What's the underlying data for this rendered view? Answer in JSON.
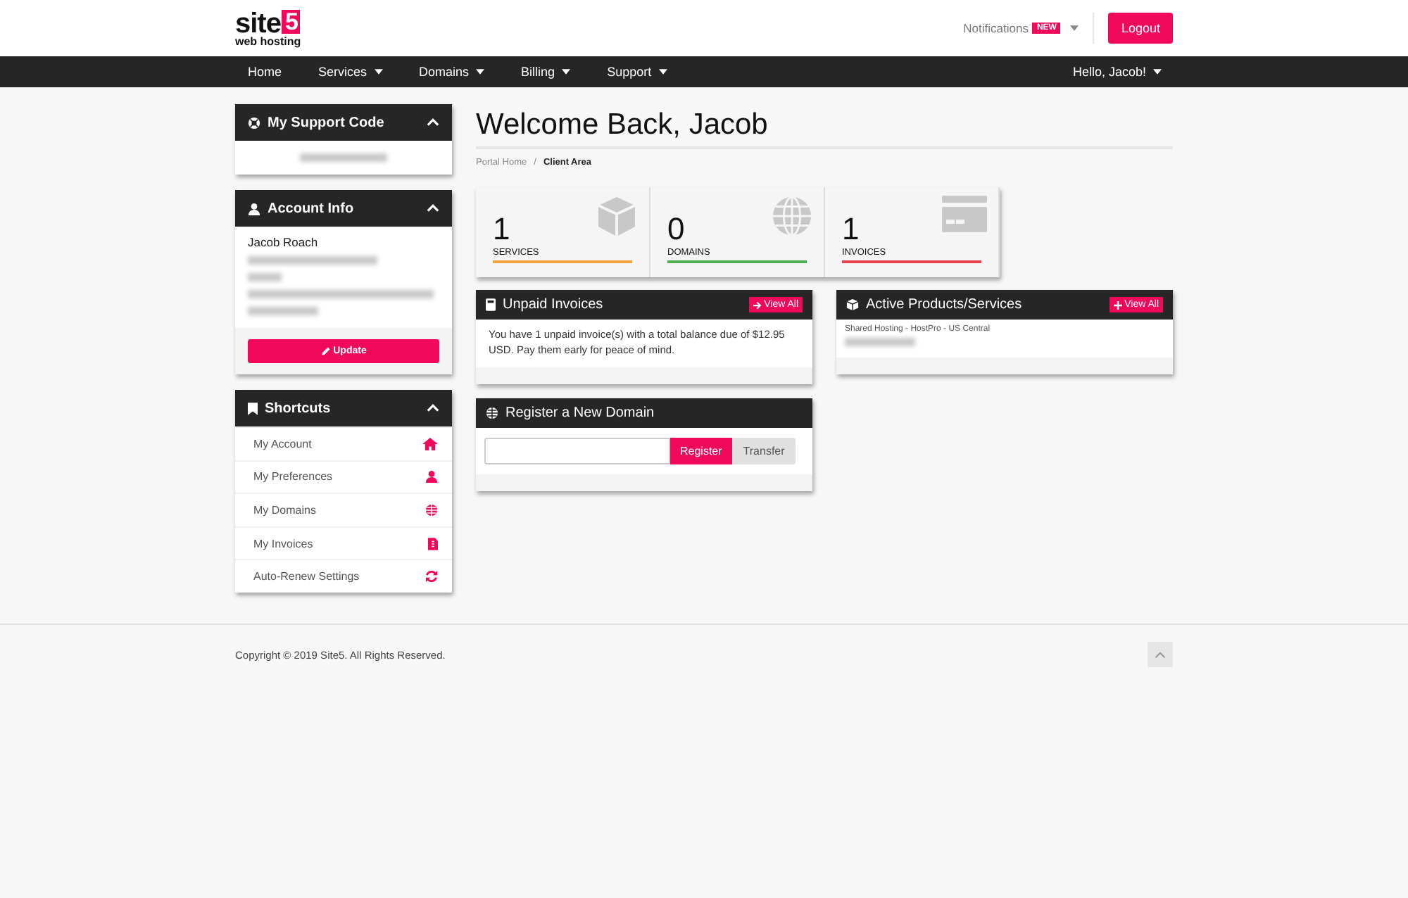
{
  "logo": {
    "name": "site",
    "mark": "5",
    "tagline": "web hosting"
  },
  "header": {
    "notifications": "Notifications",
    "badge": "NEW",
    "logout": "Logout"
  },
  "nav": {
    "items": [
      {
        "label": "Home",
        "dropdown": false
      },
      {
        "label": "Services",
        "dropdown": true
      },
      {
        "label": "Domains",
        "dropdown": true
      },
      {
        "label": "Billing",
        "dropdown": true
      },
      {
        "label": "Support",
        "dropdown": true
      }
    ],
    "user": {
      "label": "Hello, Jacob!",
      "dropdown": true
    }
  },
  "sidebar": {
    "support_code": {
      "title": "My Support Code",
      "expanded": true
    },
    "account": {
      "title": "Account Info",
      "expanded": true,
      "name": "Jacob Roach",
      "button": "Update"
    },
    "shortcuts": {
      "title": "Shortcuts",
      "expanded": true,
      "items": [
        "My Account",
        "My Preferences",
        "My Domains",
        "My Invoices",
        "Auto-Renew Settings"
      ]
    }
  },
  "page": {
    "title": "Welcome Back, Jacob",
    "breadcrumb": [
      {
        "label": "Portal Home",
        "selected": false
      },
      {
        "label": "Client Area",
        "selected": true
      }
    ],
    "separator": "/"
  },
  "stats": [
    {
      "value": "1",
      "label": "SERVICES",
      "color": "#f0a33a"
    },
    {
      "value": "0",
      "label": "DOMAINS",
      "color": "#4caf50"
    },
    {
      "value": "1",
      "label": "INVOICES",
      "color": "#e8404f"
    }
  ],
  "unpaid": {
    "title": "Unpaid Invoices",
    "button": "View All",
    "text": "You have 1 unpaid invoice(s) with a total balance due of $12.95 USD. Pay them early for peace of mind."
  },
  "products": {
    "title": "Active Products/Services",
    "button": "View All",
    "item": "Shared Hosting - HostPro - US Central"
  },
  "domain": {
    "title": "Register a New Domain",
    "register": "Register",
    "transfer": "Transfer"
  },
  "footer": {
    "copyright": "Copyright © 2019 Site5. All Rights Reserved."
  }
}
